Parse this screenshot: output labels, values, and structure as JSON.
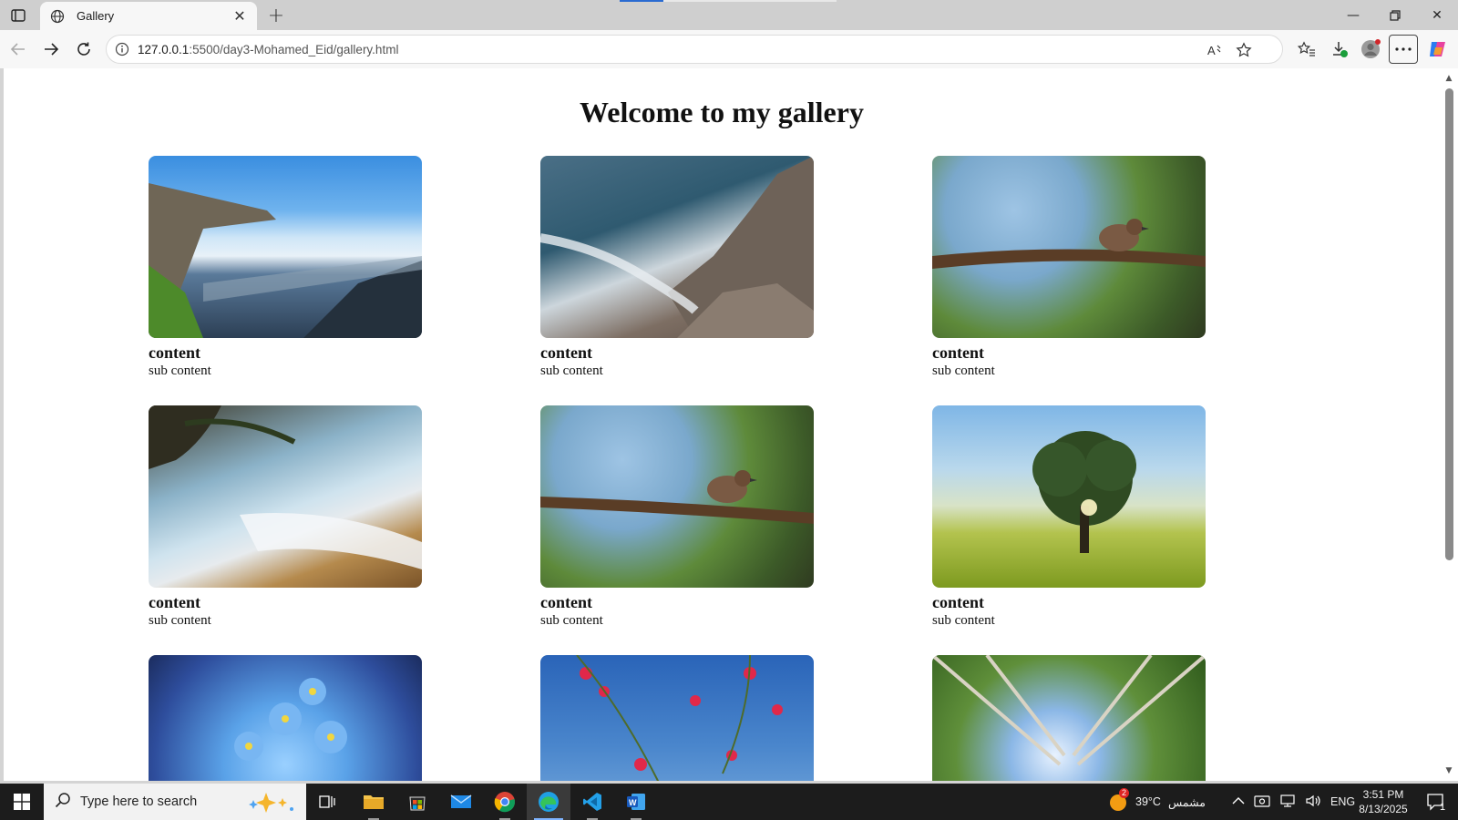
{
  "browser": {
    "tab_title": "Gallery",
    "url_host": "127.0.0.1",
    "url_path": ":5500/day3-Mohamed_Eid/gallery.html"
  },
  "page": {
    "heading": "Welcome to my gallery",
    "cards": [
      {
        "title": "content",
        "subtitle": "sub content",
        "image": "cliff-over-clouds"
      },
      {
        "title": "content",
        "subtitle": "sub content",
        "image": "rocky-seashore"
      },
      {
        "title": "content",
        "subtitle": "sub content",
        "image": "bird-on-branch"
      },
      {
        "title": "content",
        "subtitle": "sub content",
        "image": "tropical-beach"
      },
      {
        "title": "content",
        "subtitle": "sub content",
        "image": "bird-on-branch"
      },
      {
        "title": "content",
        "subtitle": "sub content",
        "image": "tree-in-field"
      },
      {
        "title": "",
        "subtitle": "",
        "image": "blue-flowers"
      },
      {
        "title": "",
        "subtitle": "",
        "image": "pink-blossoms"
      },
      {
        "title": "",
        "subtitle": "",
        "image": "forest-canopy"
      }
    ]
  },
  "taskbar": {
    "search_placeholder": "Type here to search",
    "weather_temp": "39°C",
    "weather_label": "مشمس",
    "weather_badge": "2",
    "language": "ENG",
    "time": "3:51 PM",
    "date": "8/13/2025",
    "notification_count": "1"
  },
  "colors": {
    "accent": "#2a6bd1",
    "taskbar_bg": "#1c1c1c",
    "page_bg": "#ffffff"
  }
}
